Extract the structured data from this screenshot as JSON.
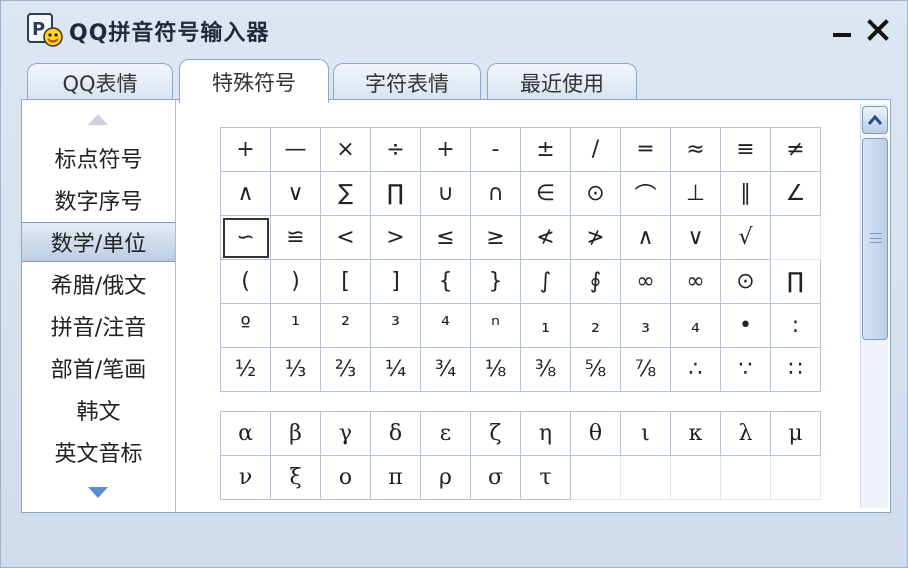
{
  "window": {
    "title": "QQ拼音符号输入器",
    "logo_icon": "qq-pinyin-logo-icon",
    "minimize_icon": "minimize-icon",
    "close_icon": "close-icon"
  },
  "tabs": [
    {
      "label": "QQ表情",
      "active": false
    },
    {
      "label": "特殊符号",
      "active": true
    },
    {
      "label": "字符表情",
      "active": false
    },
    {
      "label": "最近使用",
      "active": false
    }
  ],
  "sidebar": {
    "up_icon": "triangle-up-icon",
    "down_icon": "triangle-down-icon",
    "items": [
      {
        "label": "标点符号",
        "active": false
      },
      {
        "label": "数字序号",
        "active": false
      },
      {
        "label": "数学/单位",
        "active": true
      },
      {
        "label": "希腊/俄文",
        "active": false
      },
      {
        "label": "拼音/注音",
        "active": false
      },
      {
        "label": "部首/笔画",
        "active": false
      },
      {
        "label": "韩文",
        "active": false
      },
      {
        "label": "英文音标",
        "active": false
      }
    ]
  },
  "math_symbols": [
    [
      "+",
      "—",
      "×",
      "÷",
      "+",
      "-",
      "±",
      "/",
      "═",
      "≈",
      "≡",
      "≠"
    ],
    [
      "∧",
      "∨",
      "∑",
      "∏",
      "∪",
      "∩",
      "∈",
      "⊙",
      "⌒",
      "⊥",
      "∥",
      "∠"
    ],
    [
      "∽",
      "≌",
      "<",
      ">",
      "≤",
      "≥",
      "≮",
      "≯",
      "∧",
      "∨",
      "√",
      ""
    ],
    [
      "(",
      ")",
      "[",
      "]",
      "{",
      "}",
      "∫",
      "∮",
      "∞",
      "∞",
      "⊙",
      "∏"
    ],
    [
      "º",
      "¹",
      "²",
      "³",
      "⁴",
      "ⁿ",
      "₁",
      "₂",
      "₃",
      "₄",
      "•",
      ":"
    ],
    [
      "½",
      "⅓",
      "⅔",
      "¼",
      "¾",
      "⅛",
      "⅜",
      "⅝",
      "⅞",
      "∴",
      "∵",
      "∷"
    ]
  ],
  "greek_symbols": [
    [
      "α",
      "β",
      "γ",
      "δ",
      "ε",
      "ζ",
      "η",
      "θ",
      "ι",
      "κ",
      "λ",
      "μ"
    ],
    [
      "ν",
      "ξ",
      "ο",
      "π",
      "ρ",
      "σ",
      "τ",
      "",
      "",
      "",
      "",
      ""
    ]
  ],
  "selected_symbol": "∽",
  "scrollbar": {
    "up_icon": "scroll-up-icon",
    "grip_icon": "grip-icon"
  },
  "colors": {
    "accent": "#3c6fb5",
    "border": "#8ea7c6",
    "arrow": "#5b8ad6"
  }
}
